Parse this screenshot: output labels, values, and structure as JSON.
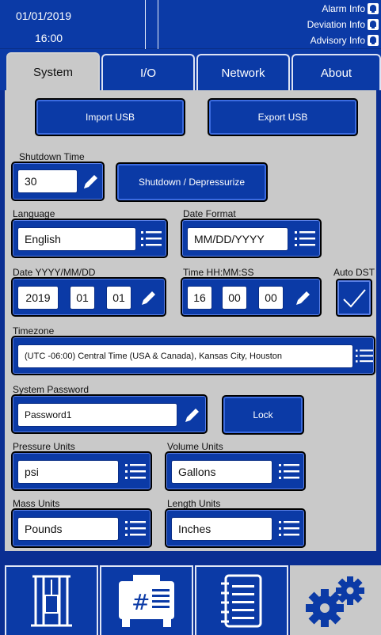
{
  "header": {
    "date": "01/01/2019",
    "time": "16:00",
    "alarm_label": "Alarm Info",
    "deviation_label": "Deviation Info",
    "advisory_label": "Advisory Info",
    "alarm_icon": "bell-icon",
    "advisory_icon": "notification-icon"
  },
  "tabs": [
    {
      "label": "System",
      "active": true
    },
    {
      "label": "I/O",
      "active": false
    },
    {
      "label": "Network",
      "active": false
    },
    {
      "label": "About",
      "active": false
    }
  ],
  "usb": {
    "import_label": "Import USB",
    "export_label": "Export USB"
  },
  "shutdown": {
    "label": "Shutdown Time",
    "value": "30",
    "button_label": "Shutdown / Depressurize"
  },
  "language": {
    "label": "Language",
    "value": "English"
  },
  "date_format": {
    "label": "Date Format",
    "value": "MM/DD/YYYY"
  },
  "date": {
    "label": "Date YYYY/MM/DD",
    "year": "2019",
    "month": "01",
    "day": "01"
  },
  "time": {
    "label": "Time HH:MM:SS",
    "hour": "16",
    "minute": "00",
    "second": "00"
  },
  "auto_dst": {
    "label": "Auto DST",
    "checked": true
  },
  "timezone": {
    "label": "Timezone",
    "value": "(UTC -06:00) Central Time (USA & Canada), Kansas City, Houston"
  },
  "password": {
    "label": "System Password",
    "value": "Password1",
    "lock_label": "Lock"
  },
  "pressure_units": {
    "label": "Pressure Units",
    "value": "psi"
  },
  "volume_units": {
    "label": "Volume Units",
    "value": "Gallons"
  },
  "mass_units": {
    "label": "Mass Units",
    "value": "Pounds"
  },
  "length_units": {
    "label": "Length Units",
    "value": "Inches"
  },
  "bottom_nav": [
    {
      "icon": "pump-rig-icon",
      "active": false
    },
    {
      "icon": "controller-icon",
      "active": false
    },
    {
      "icon": "notepad-icon",
      "active": false
    },
    {
      "icon": "gears-icon",
      "active": true
    }
  ],
  "colors": {
    "primary": "#0b3aa6",
    "panel": "#c9c9c9",
    "text_on_primary": "#ffffff"
  }
}
